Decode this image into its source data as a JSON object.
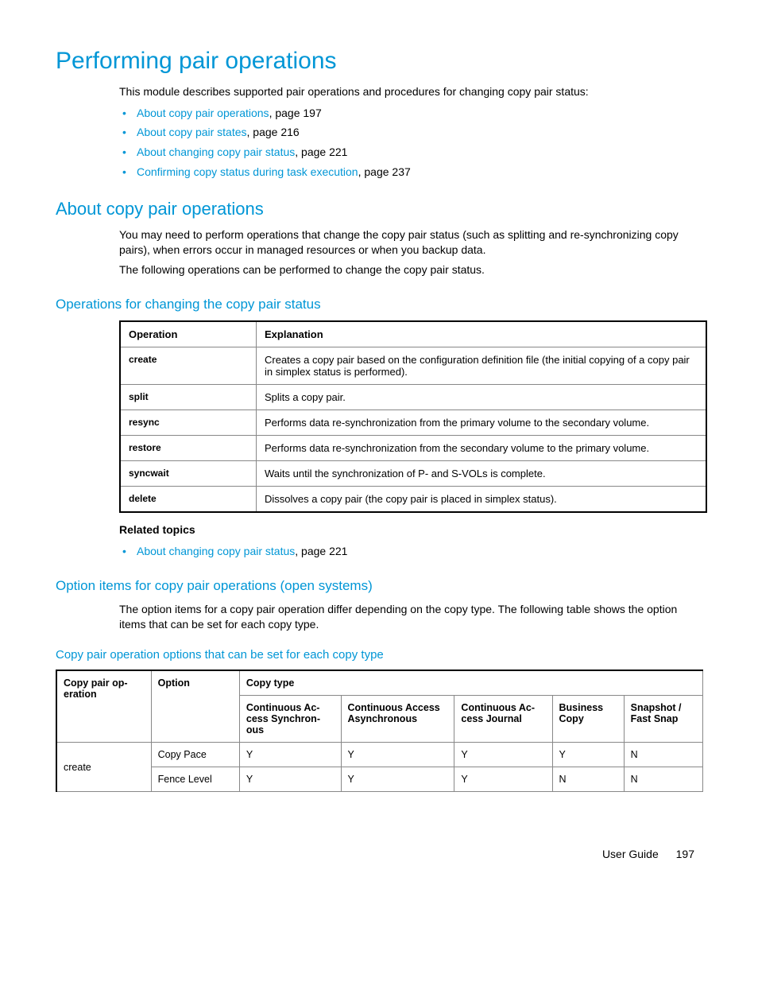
{
  "page_title": "Performing pair operations",
  "intro": "This module describes supported pair operations and procedures for changing copy pair status:",
  "toc": [
    {
      "link": "About copy pair operations",
      "suffix": ", page 197"
    },
    {
      "link": "About copy pair states",
      "suffix": ", page 216"
    },
    {
      "link": "About changing copy pair status",
      "suffix": ", page 221"
    },
    {
      "link": "Confirming copy status during task execution",
      "suffix": ", page 237"
    }
  ],
  "section1": {
    "heading": "About copy pair operations",
    "p1": "You may need to perform operations that change the copy pair status (such as splitting and re-synchronizing copy pairs), when errors occur in managed resources or when you backup data.",
    "p2": "The following operations can be performed to change the copy pair status."
  },
  "ops_table": {
    "heading": "Operations for changing the copy pair status",
    "col1": "Operation",
    "col2": "Explanation",
    "rows": [
      {
        "op": "create",
        "exp": "Creates a copy pair based on the configuration definition file (the initial copying of a copy pair in simplex status is performed)."
      },
      {
        "op": "split",
        "exp": "Splits a copy pair."
      },
      {
        "op": "resync",
        "exp": "Performs data re-synchronization from the primary volume to the secondary volume."
      },
      {
        "op": "restore",
        "exp": "Performs data re-synchronization from the secondary volume to the primary volume."
      },
      {
        "op": "syncwait",
        "exp": "Waits until the synchronization of P- and S-VOLs is complete."
      },
      {
        "op": "delete",
        "exp": "Dissolves a copy pair (the copy pair is placed in simplex status)."
      }
    ]
  },
  "related": {
    "label": "Related topics",
    "items": [
      {
        "link": "About changing copy pair status",
        "suffix": ", page 221"
      }
    ]
  },
  "section2": {
    "heading": "Option items for copy pair operations (open systems)",
    "p1": "The option items for a copy pair operation differ depending on the copy type. The following table shows the option items that can be set for each copy type."
  },
  "options_table": {
    "caption": "Copy pair operation options that can be set for each copy type",
    "h_copypairop": "Copy pair op-\neration",
    "h_option": "Option",
    "h_copytype": "Copy type",
    "h_ct1": "Continuous Ac-\ncess Synchron-\nous",
    "h_ct2": "Continuous Access\nAsynchronous",
    "h_ct3": "Continuous Ac-\ncess Journal",
    "h_ct4": "Business\nCopy",
    "h_ct5": "Snapshot /\nFast Snap",
    "rows": [
      {
        "op": "create",
        "option": "Copy Pace",
        "v": [
          "Y",
          "Y",
          "Y",
          "Y",
          "N"
        ]
      },
      {
        "op": "",
        "option": "Fence Level",
        "v": [
          "Y",
          "Y",
          "Y",
          "N",
          "N"
        ]
      }
    ]
  },
  "footer": {
    "label": "User Guide",
    "page": "197"
  }
}
